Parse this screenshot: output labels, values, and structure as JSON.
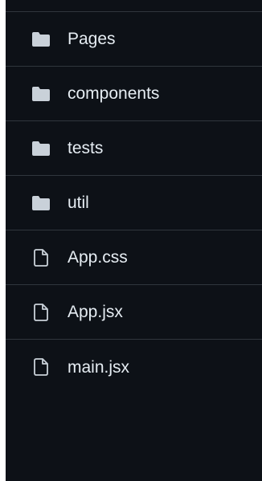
{
  "colors": {
    "background": "#0d1117",
    "divider": "#30363d",
    "text": "#e6edf3",
    "folder_icon": "#c9d1d9",
    "file_icon": "#c9d1d9"
  },
  "files": [
    {
      "name": "Pages",
      "type": "folder",
      "icon": "folder-icon"
    },
    {
      "name": "components",
      "type": "folder",
      "icon": "folder-icon"
    },
    {
      "name": "tests",
      "type": "folder",
      "icon": "folder-icon"
    },
    {
      "name": "util",
      "type": "folder",
      "icon": "folder-icon"
    },
    {
      "name": "App.css",
      "type": "file",
      "icon": "file-icon"
    },
    {
      "name": "App.jsx",
      "type": "file",
      "icon": "file-icon"
    },
    {
      "name": "main.jsx",
      "type": "file",
      "icon": "file-icon"
    }
  ]
}
